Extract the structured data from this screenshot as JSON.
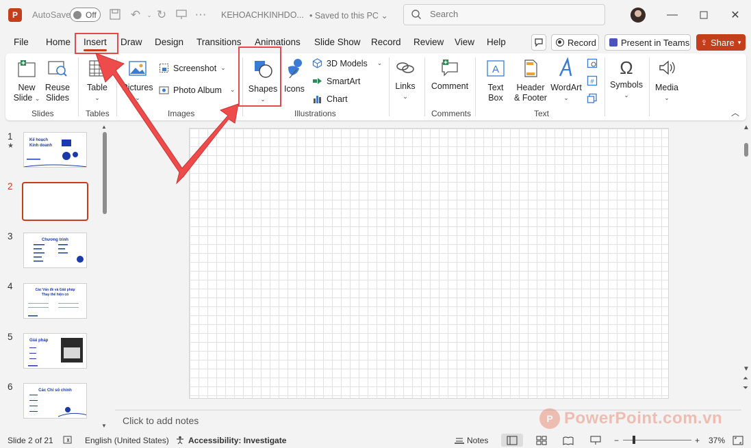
{
  "titlebar": {
    "autosave_label": "AutoSave",
    "autosave_state": "Off",
    "doc_title": "KEHOACHKINHDO...",
    "doc_status": "•  Saved to this PC ⌄",
    "search_placeholder": "Search"
  },
  "tabs": [
    "File",
    "Home",
    "Insert",
    "Draw",
    "Design",
    "Transitions",
    "Animations",
    "Slide Show",
    "Record",
    "Review",
    "View",
    "Help"
  ],
  "active_tab": "Insert",
  "toolbar_right": {
    "record_label": "Record",
    "present_label": "Present in Teams",
    "share_label": "Share"
  },
  "ribbon": {
    "slides": {
      "new_slide": "New",
      "new_slide_2": "Slide",
      "reuse": "Reuse",
      "reuse_2": "Slides",
      "group": "Slides"
    },
    "tables": {
      "table": "Table",
      "group": "Tables"
    },
    "images": {
      "pictures": "Pictures",
      "screenshot": "Screenshot",
      "photo_album": "Photo Album",
      "group": "Images"
    },
    "illustrations": {
      "shapes": "Shapes",
      "icons": "Icons",
      "models": "3D Models",
      "smartart": "SmartArt",
      "chart": "Chart",
      "group": "Illustrations"
    },
    "links": {
      "links": "Links"
    },
    "comments": {
      "comment": "Comment",
      "group": "Comments"
    },
    "text": {
      "textbox": "Text",
      "textbox_2": "Box",
      "header": "Header",
      "header_2": "& Footer",
      "wordart": "WordArt",
      "group": "Text"
    },
    "symbols": {
      "symbols": "Symbols"
    },
    "media": {
      "media": "Media"
    }
  },
  "slides": [
    {
      "num": "1",
      "title": "Kế hoạch Kinh doanh"
    },
    {
      "num": "2",
      "title": ""
    },
    {
      "num": "3",
      "title": "Chương trình"
    },
    {
      "num": "4",
      "title": "Các Vấn đề và Giải pháp Thay thế hiện có"
    },
    {
      "num": "5",
      "title": "Giải pháp"
    },
    {
      "num": "6",
      "title": "Các Chỉ số chính"
    }
  ],
  "notes_placeholder": "Click to add notes",
  "watermark": {
    "text": "PowerPoint.com.vn",
    "logo": "P"
  },
  "status": {
    "slide_info": "Slide 2 of 21",
    "language": "English (United States)",
    "accessibility": "Accessibility: Investigate",
    "notes": "Notes",
    "zoom": "37%"
  },
  "colors": {
    "accent": "#c43e1c",
    "annotation": "#e74848"
  }
}
